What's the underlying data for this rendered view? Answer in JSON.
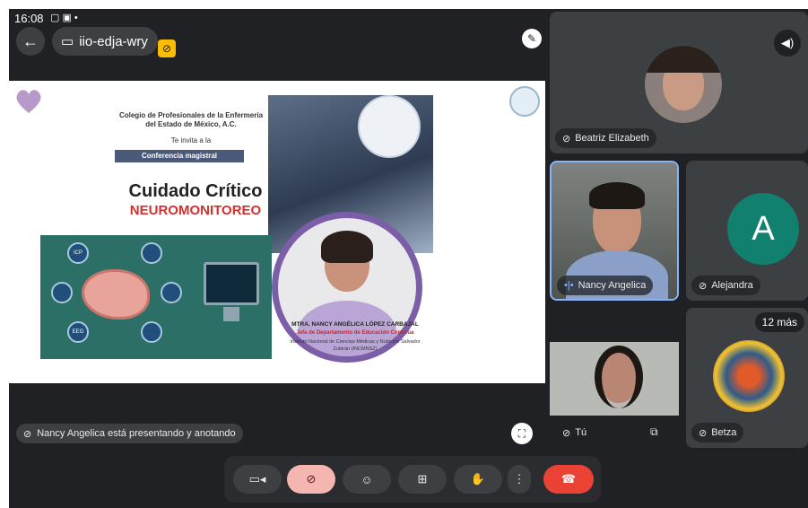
{
  "status_bar": {
    "time": "16:08",
    "icons": "▢ ▣ •",
    "right_icons": "▾ ▮"
  },
  "top_bar": {
    "back_icon": "arrow-left-icon",
    "meeting_code": "iio-edja-wry",
    "calendar_icon": "calendar-icon"
  },
  "slide": {
    "org_line": "Colegio de Profesionales de la Enfermería del Estado de México, A.C.",
    "invite": "Te invita a la",
    "conference_type": "Conferencia magistral",
    "title_line1": "Cuidado Crítico",
    "title_line2": "NEUROMONITOREO",
    "speaker_name": "MTRA. NANCY ANGÉLICA LÓPEZ CARBAJAL",
    "speaker_role": "Jefa de Departamento de Educación Continua",
    "institution": "Instituto Nacional de Ciencias Médicas y Nutrición Salvador Zubirán (INCMNSZ)",
    "node_labels": [
      "ICP",
      "EEG"
    ]
  },
  "presenting_label": "Nancy Angelica está presentando y anotando",
  "participants": [
    {
      "name": "Beatriz Elizabeth",
      "muted": true
    },
    {
      "name": "Nancy Angelica",
      "speaking": true
    },
    {
      "name": "Alejandra",
      "initial": "A",
      "muted": true
    },
    {
      "name": "Tú",
      "muted": true
    },
    {
      "name": "Betza",
      "muted": true
    }
  ],
  "more_count": "12 más",
  "colors": {
    "accent_blue": "#8ab4f8",
    "end_call_red": "#ea4335",
    "mic_off_pink": "#f5b5b0",
    "avatar_teal": "#12806f"
  }
}
